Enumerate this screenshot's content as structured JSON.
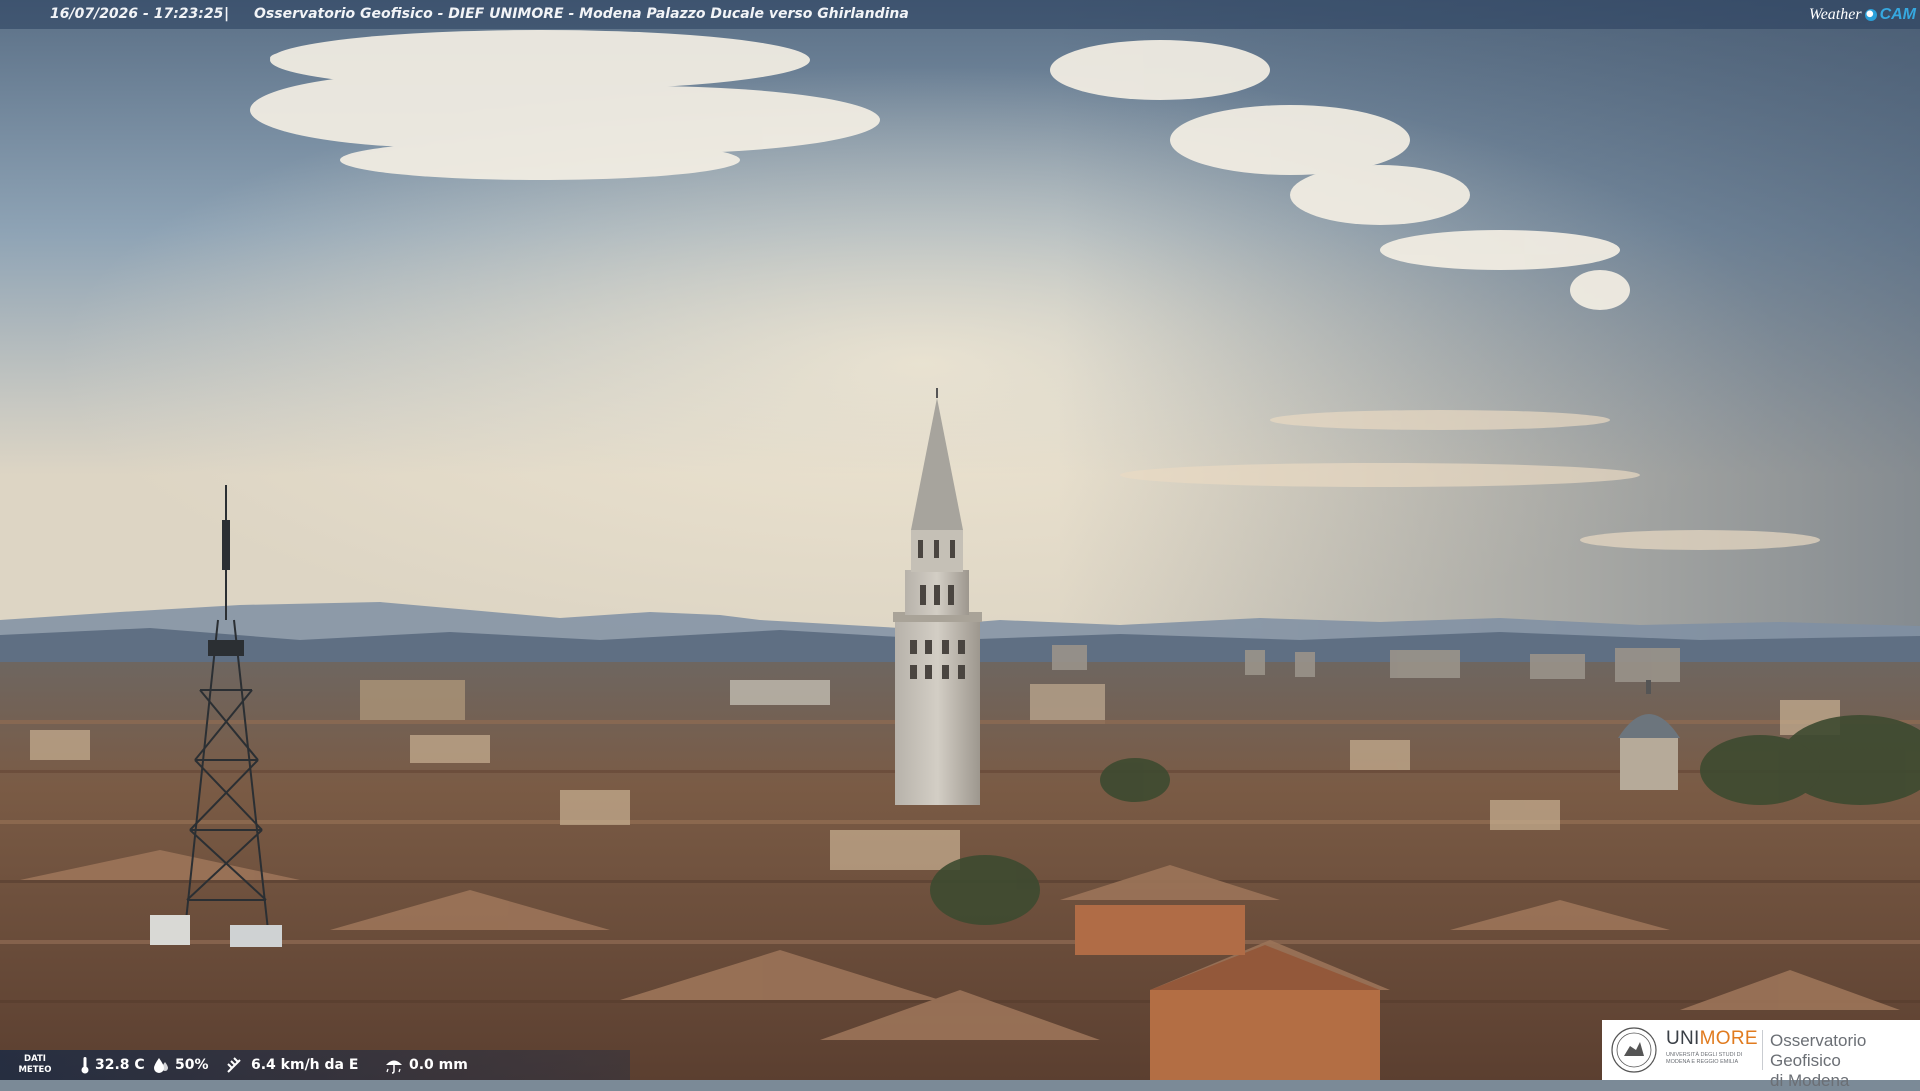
{
  "topbar": {
    "timestamp": "16/07/2026 - 17:23:25",
    "separator": "|",
    "caption": "Osservatorio Geofisico - DIEF UNIMORE - Modena Palazzo Ducale verso Ghirlandina",
    "brand_left": "Weather",
    "brand_right": "CAM"
  },
  "weather": {
    "label_line1": "DATI",
    "label_line2": "METEO",
    "temperature": "32.8 C",
    "humidity": "50%",
    "wind": "6.4 km/h da E",
    "rain": "0.0 mm",
    "icons": [
      "thermometer-icon",
      "humidity-drop-icon",
      "wind-icon",
      "rain-icon"
    ]
  },
  "logo": {
    "uni_prefix": "UNI",
    "uni_suffix": "MORE",
    "uni_subtitle": "UNIVERSITÀ DEGLI STUDI DI MODENA E REGGIO EMILIA",
    "observatory_line1": "Osservatorio Geofisico",
    "observatory_line2": "di Modena"
  },
  "colors": {
    "sky_top": "#5f7388",
    "sky_glow": "#e9e1cf",
    "rooftops": "#7a5a44",
    "brand_blue": "#36a8e0",
    "unimore_orange": "#e07b1f"
  }
}
